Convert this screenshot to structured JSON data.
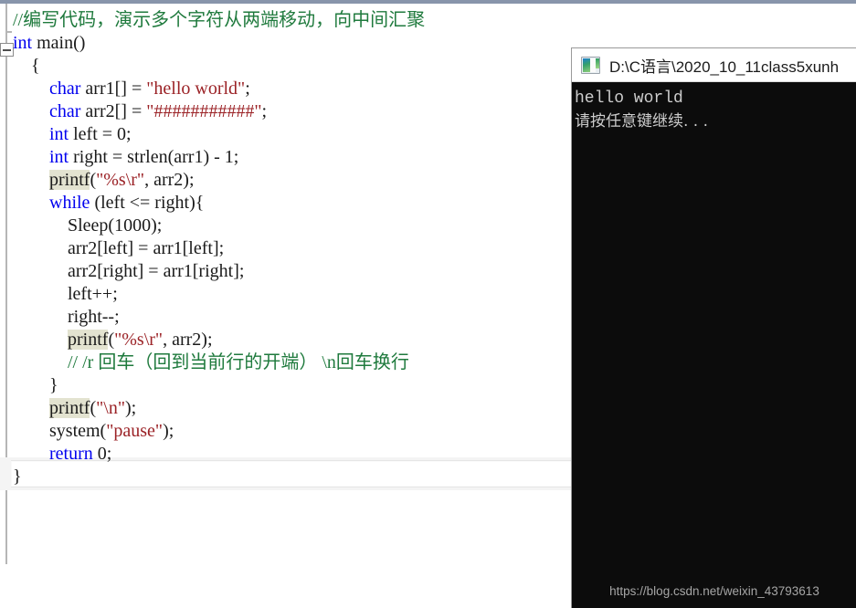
{
  "editor": {
    "name": "visual-studio-code-editor",
    "fold_marker": "minus",
    "colors": {
      "keyword": "#0000ef",
      "string": "#9b2226",
      "comment": "#1f7a3d",
      "plain": "#1a1a1a",
      "highlight_bg": "#e3e3d0",
      "current_line_bg": "#f4f4f4",
      "top_border": "#8895ab"
    },
    "current_line_number": 17,
    "lines": [
      {
        "indent": 0,
        "tokens": [
          {
            "t": "comment",
            "v": "//编写代码，演示多个字符从两端移动，向中间汇聚"
          }
        ]
      },
      {
        "indent": 0,
        "tokens": [
          {
            "t": "keyword",
            "v": "int"
          },
          {
            "t": "plain",
            "v": " main()"
          }
        ]
      },
      {
        "indent": 1,
        "tokens": [
          {
            "t": "plain",
            "v": "{"
          }
        ]
      },
      {
        "indent": 2,
        "tokens": [
          {
            "t": "keyword",
            "v": "char"
          },
          {
            "t": "plain",
            "v": " arr1[] = "
          },
          {
            "t": "string",
            "v": "\"hello world\""
          },
          {
            "t": "plain",
            "v": ";"
          }
        ]
      },
      {
        "indent": 2,
        "tokens": [
          {
            "t": "keyword",
            "v": "char"
          },
          {
            "t": "plain",
            "v": " arr2[] = "
          },
          {
            "t": "string",
            "v": "\"###########\""
          },
          {
            "t": "plain",
            "v": ";"
          }
        ]
      },
      {
        "indent": 2,
        "tokens": [
          {
            "t": "keyword",
            "v": "int"
          },
          {
            "t": "plain",
            "v": " left = 0;"
          }
        ]
      },
      {
        "indent": 2,
        "tokens": [
          {
            "t": "keyword",
            "v": "int"
          },
          {
            "t": "plain",
            "v": " right = strlen(arr1) - 1;"
          }
        ]
      },
      {
        "indent": 2,
        "tokens": [
          {
            "t": "highlight",
            "v": "printf"
          },
          {
            "t": "plain",
            "v": "("
          },
          {
            "t": "string",
            "v": "\"%s\\r\""
          },
          {
            "t": "plain",
            "v": ", arr2);"
          }
        ]
      },
      {
        "indent": 2,
        "tokens": [
          {
            "t": "keyword",
            "v": "while"
          },
          {
            "t": "plain",
            "v": " (left <= right){"
          }
        ]
      },
      {
        "indent": 3,
        "tokens": [
          {
            "t": "plain",
            "v": "Sleep(1000);"
          }
        ]
      },
      {
        "indent": 3,
        "tokens": [
          {
            "t": "plain",
            "v": "arr2[left] = arr1[left];"
          }
        ]
      },
      {
        "indent": 3,
        "tokens": [
          {
            "t": "plain",
            "v": "arr2[right] = arr1[right];"
          }
        ]
      },
      {
        "indent": 3,
        "tokens": [
          {
            "t": "plain",
            "v": "left++;"
          }
        ]
      },
      {
        "indent": 3,
        "tokens": [
          {
            "t": "plain",
            "v": "right--;"
          }
        ]
      },
      {
        "indent": 3,
        "tokens": [
          {
            "t": "highlight",
            "v": "printf"
          },
          {
            "t": "plain",
            "v": "("
          },
          {
            "t": "string",
            "v": "\"%s\\r\""
          },
          {
            "t": "plain",
            "v": ", arr2);"
          }
        ]
      },
      {
        "indent": 3,
        "tokens": [
          {
            "t": "comment",
            "v": "// /r 回车（回到当前行的开端） \\n回车换行"
          }
        ]
      },
      {
        "indent": 2,
        "tokens": [
          {
            "t": "plain",
            "v": "}"
          }
        ]
      },
      {
        "indent": 2,
        "tokens": [
          {
            "t": "highlight",
            "v": "printf"
          },
          {
            "t": "plain",
            "v": "("
          },
          {
            "t": "string",
            "v": "\"\\n\""
          },
          {
            "t": "plain",
            "v": ");"
          }
        ]
      },
      {
        "indent": 2,
        "tokens": [
          {
            "t": "plain",
            "v": "system("
          },
          {
            "t": "string",
            "v": "\"pause\""
          },
          {
            "t": "plain",
            "v": ");"
          }
        ]
      },
      {
        "indent": 2,
        "tokens": [
          {
            "t": "keyword",
            "v": "return"
          },
          {
            "t": "plain",
            "v": " 0;"
          }
        ]
      },
      {
        "indent": 0,
        "tokens": [
          {
            "t": "plain",
            "v": "}"
          }
        ]
      }
    ]
  },
  "console": {
    "title": "D:\\C语言\\2020_10_11class5xunh",
    "icon": "console-window-icon",
    "output_lines": [
      "hello world",
      "请按任意键继续. . ."
    ],
    "background": "#0c0c0c",
    "text_color": "#cccccc"
  },
  "watermark": {
    "text": "https://blog.csdn.net/weixin_43793613"
  }
}
